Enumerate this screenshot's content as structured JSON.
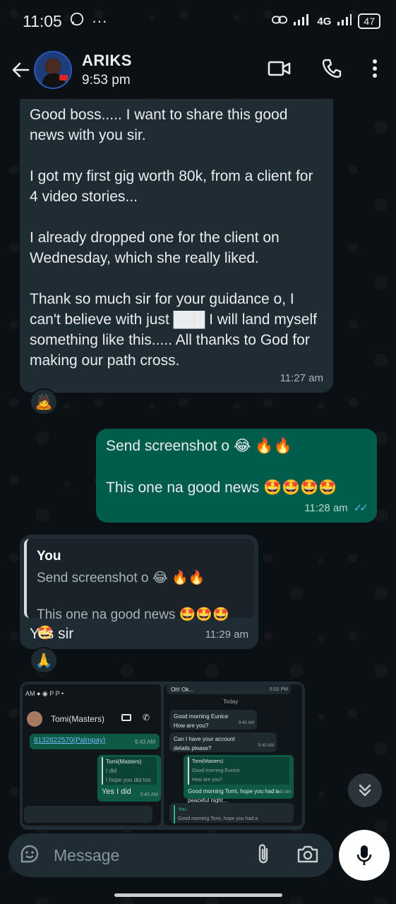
{
  "status_bar": {
    "time": "11:05",
    "extra": "···",
    "network": "4G",
    "battery": "47"
  },
  "header": {
    "contact_name": "ARIKS",
    "last_seen": "9:53 pm"
  },
  "messages": [
    {
      "paragraphs": [
        "Good boss..... I want to share this good news with you sir.",
        "I got my first gig worth 80k, from a client for 4 video stories...",
        "I already dropped one for the client on Wednesday, which she really liked.",
        "Thank so much sir for your guidance o, I can't believe with just ███ I will land myself something like this..... All thanks to God for making our path cross."
      ],
      "time": "11:27 am",
      "reaction": "🙇"
    },
    {
      "line1": "Send screenshot o 😂 🔥🔥",
      "line2": "This one na good news 🤩🤩🤩🤩",
      "time": "11:28 am",
      "ticks": "✓✓"
    },
    {
      "quote_author": "You",
      "quote_line1": "Send screenshot o 😂 🔥🔥",
      "quote_line2": "This one na good news 🤩🤩🤩🤩",
      "text": "Yes sir",
      "time": "11:29 am",
      "reaction": "🙏"
    }
  ],
  "image_preview_1": {
    "status": "AM",
    "contact": "Tomi(Masters)",
    "account_line": "8132822570(Palmpay)",
    "account_time": "9:43 AM",
    "quote_author": "Tomi(Masters)",
    "quote_line1": "I did",
    "quote_line2": "I hope you did too",
    "reply": "Yes I did",
    "reply_time": "9:45 AM"
  },
  "image_preview_2": {
    "top": "Oh! Ok...",
    "top_time": "5:02 PM",
    "day": "Today",
    "m1": "Good morning Eunice",
    "m1b": "How are you?",
    "m1_time": "9:40 AM",
    "m2": "Can I have your account details please?",
    "m2_time": "9:40 AM",
    "q_author": "Tomi(Masters)",
    "q_line1": "Good morning Eunice",
    "q_line2": "How are you?",
    "reply": "Good morning Tomi, hope you had a peaceful night...",
    "reply_time": "9:42 AM",
    "bottom_author": "You",
    "bottom_text": "Good morning Tomi, hope you had a"
  },
  "composer": {
    "placeholder": "Message"
  }
}
